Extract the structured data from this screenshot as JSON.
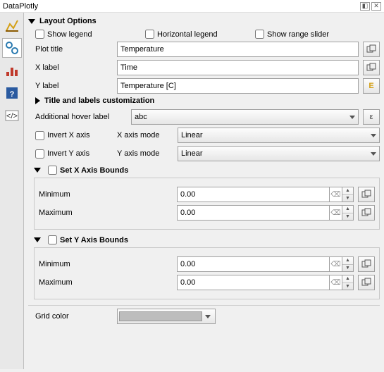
{
  "window": {
    "title": "DataPlotly"
  },
  "layout": {
    "header": "Layout Options",
    "show_legend": "Show legend",
    "horizontal_legend": "Horizontal legend",
    "show_range_slider": "Show range slider",
    "plot_title_lbl": "Plot title",
    "plot_title_val": "Temperature",
    "x_label_lbl": "X label",
    "x_label_val": "Time",
    "y_label_lbl": "Y label",
    "y_label_val": "Temperature [C]",
    "custom_header": "Title and labels customization",
    "hover_lbl": "Additional hover label",
    "hover_val": "abc",
    "invert_x": "Invert X axis",
    "invert_y": "Invert Y axis",
    "x_mode_lbl": "X axis mode",
    "x_mode_val": "Linear",
    "y_mode_lbl": "Y axis mode",
    "y_mode_val": "Linear",
    "set_x": "Set X Axis Bounds",
    "set_y": "Set Y Axis Bounds",
    "min_lbl": "Minimum",
    "max_lbl": "Maximum",
    "x_min": "0.00",
    "x_max": "0.00",
    "y_min": "0.00",
    "y_max": "0.00",
    "grid_lbl": "Grid color"
  },
  "glyph": {
    "eps": "ε",
    "expr": "E"
  }
}
